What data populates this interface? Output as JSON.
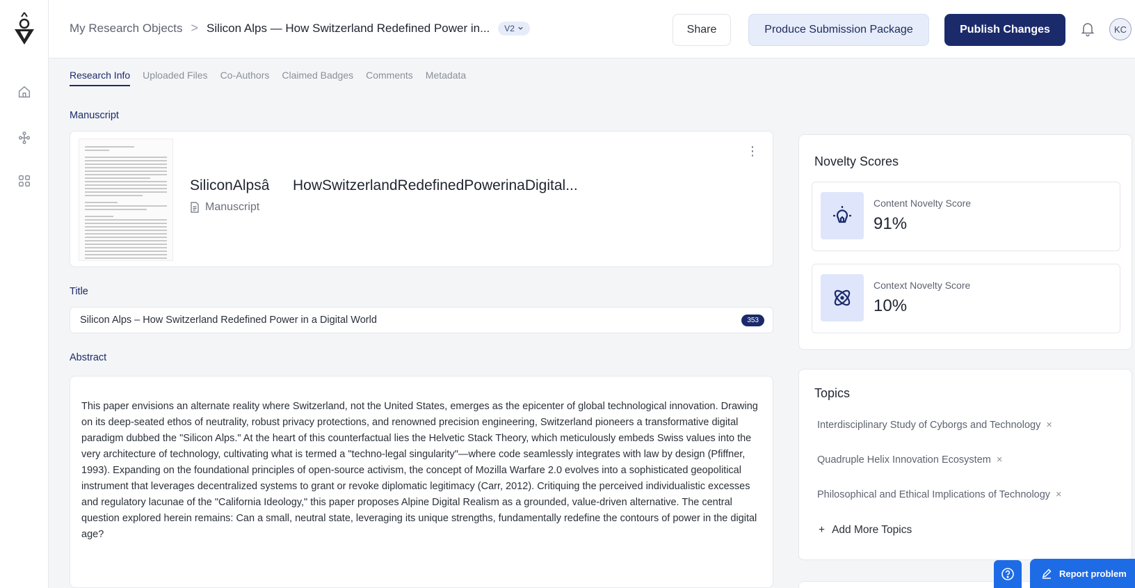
{
  "breadcrumb": {
    "root": "My Research Objects",
    "separator": ">",
    "current": "Silicon Alps — How Switzerland Redefined Power in...",
    "version": "V2"
  },
  "header": {
    "share_label": "Share",
    "package_label": "Produce Submission Package",
    "publish_label": "Publish Changes",
    "avatar_initials": "KC"
  },
  "rail": {
    "items": [
      "home-icon",
      "network-icon",
      "grid-icon"
    ]
  },
  "tabs": [
    {
      "label": "Research Info",
      "active": true
    },
    {
      "label": "Uploaded Files",
      "active": false
    },
    {
      "label": "Co-Authors",
      "active": false
    },
    {
      "label": "Claimed Badges",
      "active": false
    },
    {
      "label": "Comments",
      "active": false
    },
    {
      "label": "Metadata",
      "active": false
    }
  ],
  "manuscript": {
    "section_label": "Manuscript",
    "file_title": "SiliconAlpsâHowSwitzerlandRedefinedPowerinaDigital...",
    "file_type": "Manuscript"
  },
  "title_field": {
    "section_label": "Title",
    "value": "Silicon Alps – How Switzerland Redefined Power in a Digital World",
    "count": "353"
  },
  "abstract": {
    "section_label": "Abstract",
    "text": "This paper envisions an alternate reality where Switzerland, not the United States, emerges as the epicenter of global technological innovation. Drawing on its deep-seated ethos of neutrality, robust privacy protections, and renowned precision engineering, Switzerland pioneers a transformative digital paradigm dubbed the \"Silicon Alps.\" At the heart of this counterfactual lies the Helvetic Stack Theory, which meticulously embeds Swiss values into the very architecture of technology, cultivating what is termed a \"techno-legal singularity\"—where code seamlessly integrates with law by design (Pfiffner, 1993). Expanding on the foundational principles of open-source activism, the concept of Mozilla Warfare 2.0 evolves into a sophisticated geopolitical instrument that leverages decentralized systems to grant or revoke diplomatic legitimacy (Carr, 2012). Critiquing the perceived individualistic excesses and regulatory lacunae of the \"California Ideology,\" this paper proposes Alpine Digital Realism as a grounded, value-driven alternative. The central question explored herein remains: Can a small, neutral state, leveraging its unique strengths, fundamentally redefine the contours of power in the digital age?"
  },
  "novelty": {
    "title": "Novelty Scores",
    "content_label": "Content Novelty Score",
    "content_value": "91%",
    "context_label": "Context Novelty Score",
    "context_value": "10%"
  },
  "topics": {
    "title": "Topics",
    "items": [
      "Interdisciplinary Study of Cyborgs and Technology",
      "Quadruple Helix Innovation Ecosystem",
      "Philosophical and Ethical Implications of Technology"
    ],
    "add_label": "Add More Topics"
  },
  "footer": {
    "report_label": "Report problem"
  },
  "colors": {
    "primary": "#1b2a6b",
    "accent_blue": "#1e6be6",
    "icon_bg": "#dfe6fb"
  }
}
